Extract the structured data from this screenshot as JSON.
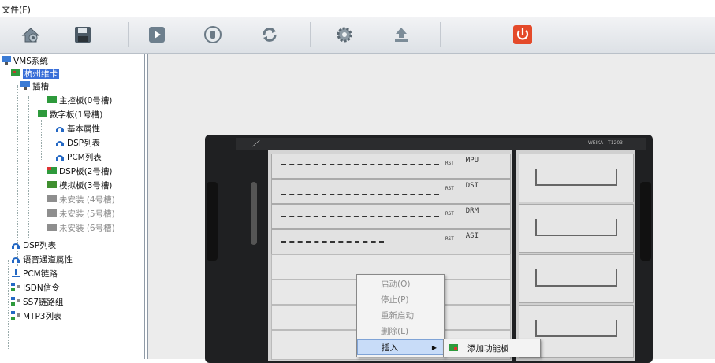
{
  "menubar": {
    "file": "文件(F)"
  },
  "toolbar": {
    "buttons": [
      "settings-home-icon",
      "save-icon",
      "play-icon",
      "stop-icon",
      "refresh-icon",
      "gear-icon",
      "upload-icon",
      "power-icon"
    ]
  },
  "tree": {
    "root": "VMS系统",
    "card": "杭州维卡",
    "slot": "插槽",
    "main_board": "主控板(0号槽)",
    "digital_board": "数字板(1号槽)",
    "basic_props": "基本属性",
    "dsp_list": "DSP列表",
    "pcm_list": "PCM列表",
    "dsp_board": "DSP板(2号槽)",
    "analog_board": "模拟板(3号槽)",
    "uninstalled_4": "未安装 (4号槽)",
    "uninstalled_5": "未安装 (5号槽)",
    "uninstalled_6": "未安装 (6号槽)",
    "dsp_list2": "DSP列表",
    "voice_channel": "语音通道属性",
    "pcm_link": "PCM链路",
    "isdn": "ISDN信令",
    "ss7": "SS7链路组",
    "mtp3": "MTP3列表"
  },
  "device": {
    "brand": "WEIKA---T1203",
    "cards": [
      "MPU",
      "DSI",
      "DRM",
      "ASI"
    ],
    "rst": "RST"
  },
  "context_menu": {
    "start": "启动(O)",
    "stop": "停止(P)",
    "restart": "重新启动",
    "delete": "删除(L)",
    "insert": "插入",
    "arrow": "▶"
  },
  "submenu": {
    "add_board": "添加功能板"
  }
}
